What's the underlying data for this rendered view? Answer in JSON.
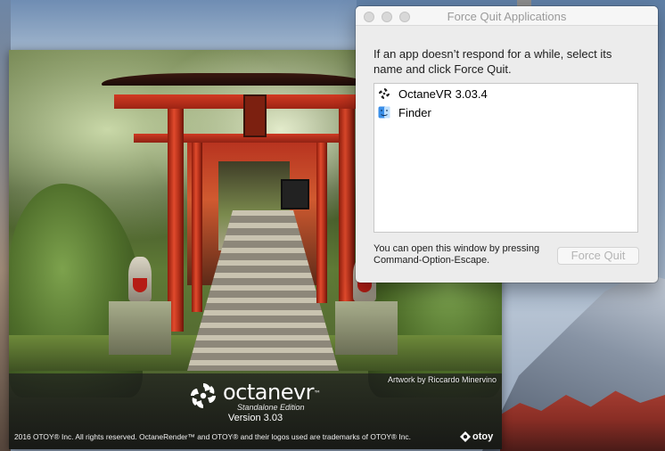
{
  "splash": {
    "credit": "Artwork by Riccardo Minervino",
    "brand_name": "octanevr",
    "brand_tm": "™",
    "brand_edition": "Standalone Edition",
    "version": "Version 3.03",
    "legal": "2016 OTOY® Inc. All rights reserved. OctaneRender™ and OTOY® and their logos used are trademarks of OTOY® Inc.",
    "otoy_word": "otoy"
  },
  "force_quit": {
    "title": "Force Quit Applications",
    "message": "If an app doesn’t respond for a while, select its name and click Force Quit.",
    "apps": [
      {
        "label": "OctaneVR 3.03.4",
        "icon": "octane-app-icon"
      },
      {
        "label": "Finder",
        "icon": "finder-icon"
      }
    ],
    "hint": "You can open this window by pressing Command-Option-Escape.",
    "button_label": "Force Quit",
    "button_enabled": false
  }
}
